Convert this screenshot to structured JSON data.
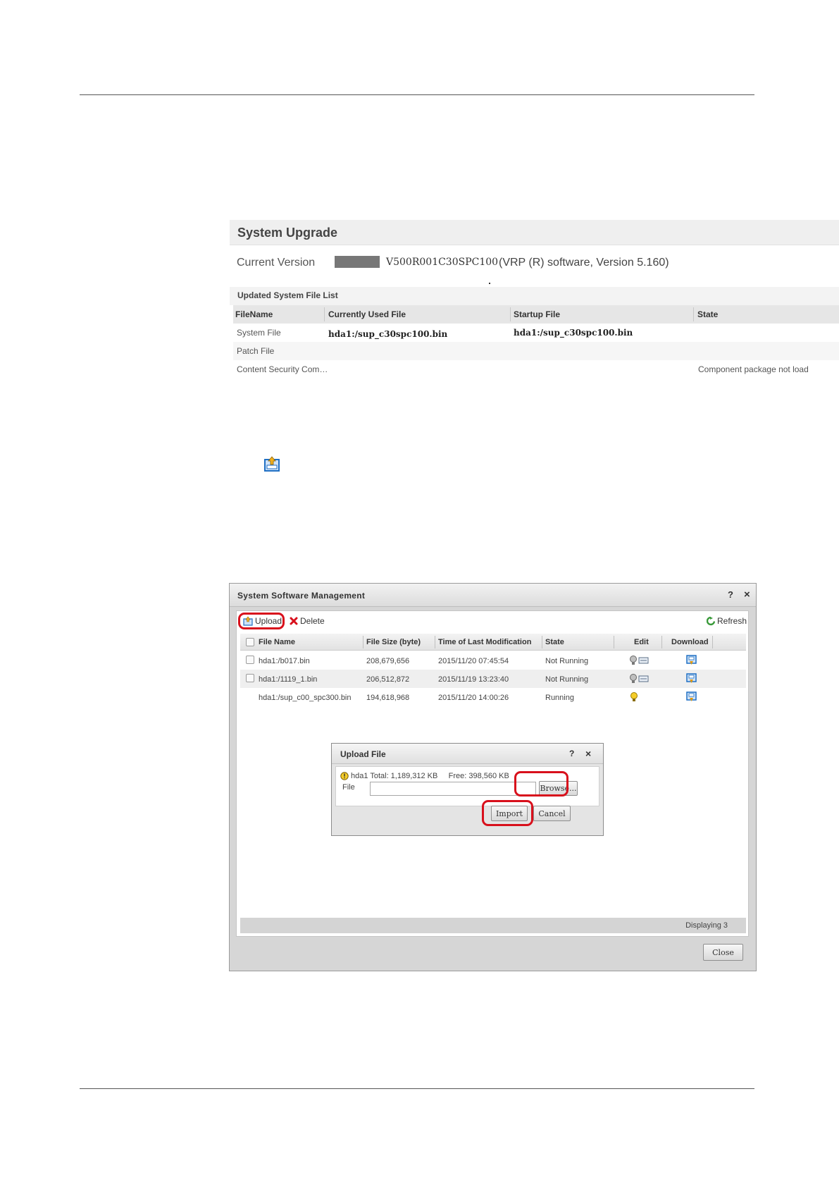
{
  "system_upgrade": {
    "title": "System Upgrade",
    "current_version_label": "Current Version",
    "current_version": "V500R001C30SPC100",
    "version_description": "(VRP (R) software, Version 5.160)",
    "file_list_title": "Updated System File List",
    "columns": [
      "FileName",
      "Currently Used File",
      "Startup File",
      "State"
    ],
    "rows": [
      {
        "name": "System File",
        "current": "hda1:/sup_c30spc100.bin",
        "startup": "hda1:/sup_c30spc100.bin",
        "state": ""
      },
      {
        "name": "Patch File",
        "current": "",
        "startup": "",
        "state": ""
      },
      {
        "name": "Content Security Com…",
        "current": "",
        "startup": "",
        "state": "Component package not load"
      }
    ]
  },
  "software_mgmt": {
    "title": "System Software Management",
    "help_glyph": "?",
    "close_glyph": "×",
    "toolbar": {
      "upload_label": "Upload",
      "delete_label": "Delete",
      "refresh_label": "Refresh"
    },
    "columns": [
      "File Name",
      "File Size (byte)",
      "Time of Last Modification",
      "State",
      "Edit",
      "Download"
    ],
    "rows": [
      {
        "name": "hda1:/b017.bin",
        "size": "208,679,656",
        "modified": "2015/11/20 07:45:54",
        "state": "Not Running"
      },
      {
        "name": "hda1:/1119_1.bin",
        "size": "206,512,872",
        "modified": "2015/11/19 13:23:40",
        "state": "Not Running"
      },
      {
        "name": "hda1:/sup_c00_spc300.bin",
        "size": "194,618,968",
        "modified": "2015/11/20 14:00:26",
        "state": "Running"
      }
    ],
    "status_text": "Displaying 3",
    "close_button": "Close"
  },
  "upload_dialog": {
    "title": "Upload File",
    "help_glyph": "?",
    "close_glyph": "×",
    "disk_info": "hda1 Total: 1,189,312 KB     Free: 398,560 KB",
    "file_label": "File",
    "file_value": "",
    "browse_button": "Browse...",
    "import_button": "Import",
    "cancel_button": "Cancel"
  },
  "colors": {
    "highlight": "#d8101c",
    "accent_icon": "#1f6fc4"
  },
  "icons": {
    "upload": "upload-icon",
    "delete": "delete-x-icon",
    "refresh": "refresh-icon",
    "edit": "bulb-edit-icon",
    "download": "download-icon",
    "warning": "warning-icon"
  }
}
